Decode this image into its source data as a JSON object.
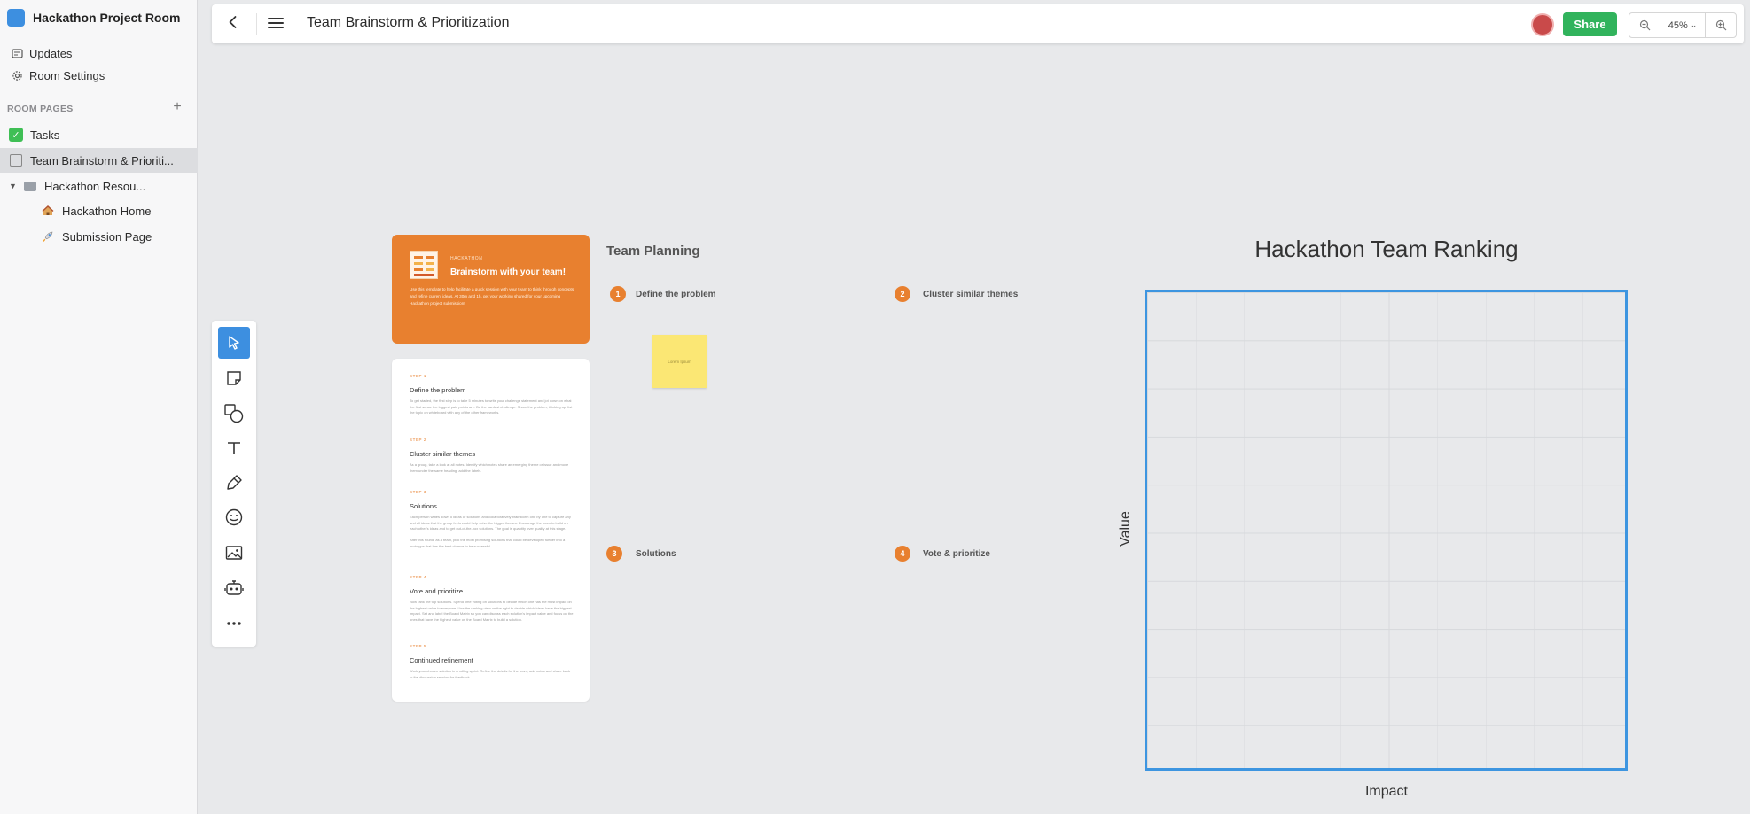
{
  "sidebar": {
    "room_title": "Hackathon Project Room",
    "links": [
      {
        "label": "Updates",
        "icon": "updates-icon"
      },
      {
        "label": "Room Settings",
        "icon": "gear-icon"
      }
    ],
    "section_label": "ROOM PAGES",
    "add_label": "+",
    "pages": [
      {
        "label": "Tasks",
        "icon": "checkbox-icon"
      },
      {
        "label": "Team Brainstorm & Prioriti...",
        "icon": "whiteboard-icon",
        "active": true
      },
      {
        "label": "Hackathon Resou...",
        "icon": "folder-icon",
        "expanded": true
      },
      {
        "label": "Hackathon Home",
        "icon": "house-emoji-icon"
      },
      {
        "label": "Submission Page",
        "icon": "rocket-emoji-icon"
      }
    ]
  },
  "topbar": {
    "title": "Team Brainstorm & Prioritization",
    "share_label": "Share",
    "zoom_value": "45%",
    "zoom_caret": "⌄"
  },
  "tools": [
    "select-tool",
    "sticky-note-tool",
    "shapes-tool",
    "text-tool",
    "pen-tool",
    "emoji-tool",
    "image-tool",
    "ai-robot-tool",
    "more-tool"
  ],
  "canvas": {
    "intro": {
      "kicker": "HACKATHON",
      "title": "Brainstorm with your team!",
      "description": "Use this template to help facilitate a quick session with your team to think through concepts and refine current ideas. At 30m and 1h, get your working shared for your upcoming Hackathon project submission!"
    },
    "steps": [
      {
        "kicker": "STEP 1",
        "title": "Define the problem",
        "desc": "To get started, the first step is to take 5 minutes to write your challenge statement and jot down on what the first sense the biggest pain points are. Be the hardest challenge. Share the problem, thinking up, list the topic on whiteboard with any of the other frameworks."
      },
      {
        "kicker": "STEP 2",
        "title": "Cluster similar themes",
        "desc": "As a group, take a look at all notes. Identify which notes share an emerging theme or issue and move them under the same heading, add the labels."
      },
      {
        "kicker": "STEP 3",
        "title": "Solutions",
        "desc": "Each person writes down 5 ideas or solutions and collaboratively brainstorm one by one to capture any and all ideas that the group feels could help solve the bigger themes. Encourage the team to build on each other's ideas and to get out-of-the-box solutions. The goal is quantity over quality at this stage.\n\nAfter this round, as a team, pick the most promising solutions that could be developed further into a prototype that has the best chance to be successful."
      },
      {
        "kicker": "STEP 4",
        "title": "Vote and prioritize",
        "desc": "Now rank the top solutions. Spend time voting on solutions to decide which one has the most impact on the highest value to everyone. Use the ranking view on the right to decide which ideas have the biggest impact. Set and label the Board Matrix so you can discuss each solution's impact value and focus on the ones that have the highest value on the Board Matrix to build a solution."
      },
      {
        "kicker": "STEP 5",
        "title": "Continued refinement",
        "desc": "Work your chosen solution in a rolling sprint. Refine the details for the team, add notes and share back to the discussion session for feedback."
      }
    ],
    "team_planning": {
      "heading": "Team Planning",
      "items": [
        {
          "num": "1",
          "label": "Define the problem"
        },
        {
          "num": "2",
          "label": "Cluster similar themes"
        },
        {
          "num": "3",
          "label": "Solutions"
        },
        {
          "num": "4",
          "label": "Vote & prioritize"
        }
      ],
      "sticky_text": "Lorem Ipsum",
      "sticky_color": "#fbe774"
    },
    "ranking": {
      "title": "Hackathon Team Ranking",
      "x_axis": "Impact",
      "y_axis": "Value",
      "border_color": "#3d95e0"
    }
  },
  "colors": {
    "accent": "#3d8fe0",
    "share": "#31b35c",
    "orange": "#e8802f"
  }
}
